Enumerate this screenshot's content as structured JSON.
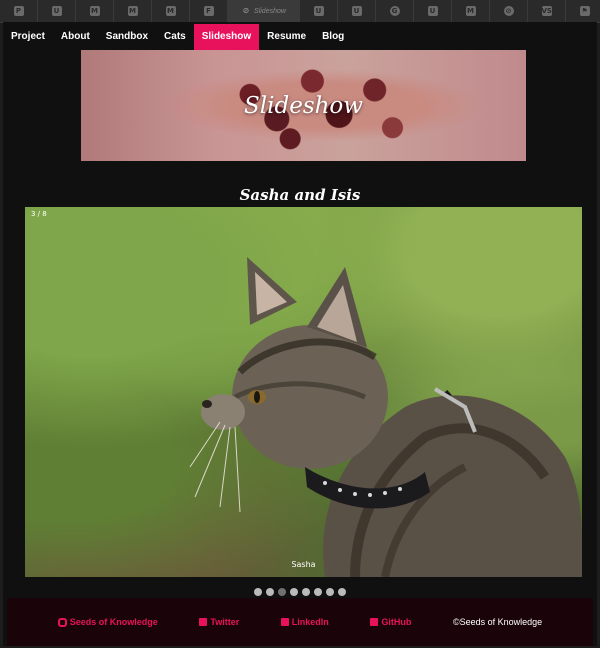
{
  "browser": {
    "tabs": [
      {
        "icon": "pocket-icon",
        "glyph": "P"
      },
      {
        "icon": "shield-icon",
        "glyph": "U"
      },
      {
        "icon": "medium-icon",
        "glyph": "M"
      },
      {
        "icon": "medium-icon",
        "glyph": "M"
      },
      {
        "icon": "medium-icon",
        "glyph": "M"
      },
      {
        "icon": "file-icon",
        "glyph": "F"
      },
      {
        "icon": "globe-icon",
        "glyph": "⊘",
        "label": "Slideshow",
        "active": true
      },
      {
        "icon": "shield-icon",
        "glyph": "U"
      },
      {
        "icon": "shield-icon",
        "glyph": "U"
      },
      {
        "icon": "github-icon",
        "glyph": "G"
      },
      {
        "icon": "shield-icon",
        "glyph": "U"
      },
      {
        "icon": "medium-icon",
        "glyph": "M"
      },
      {
        "icon": "compass-icon",
        "glyph": "⊘"
      },
      {
        "icon": "vs-icon",
        "glyph": "VS"
      },
      {
        "icon": "flag-icon",
        "glyph": "⚑"
      }
    ]
  },
  "nav": {
    "items": [
      "Project",
      "About",
      "Sandbox",
      "Cats",
      "Slideshow",
      "Resume",
      "Blog"
    ],
    "active": "Slideshow"
  },
  "banner": {
    "title": "Slideshow"
  },
  "slideshow": {
    "title": "Sasha and Isis",
    "counter": "3 / 8",
    "caption": "Sasha",
    "total": 8,
    "current": 3
  },
  "footer": {
    "links": [
      {
        "label": "Seeds of Knowledge",
        "icon": "link-icon"
      },
      {
        "label": "Twitter",
        "icon": "twitter-icon"
      },
      {
        "label": "LinkedIn",
        "icon": "linkedin-icon"
      },
      {
        "label": "GitHub",
        "icon": "github-icon"
      }
    ],
    "copyright": "©Seeds of Knowledge"
  },
  "colors": {
    "accent": "#e8125c",
    "page_bg": "#111010",
    "footer_bg": "#1a0409"
  }
}
